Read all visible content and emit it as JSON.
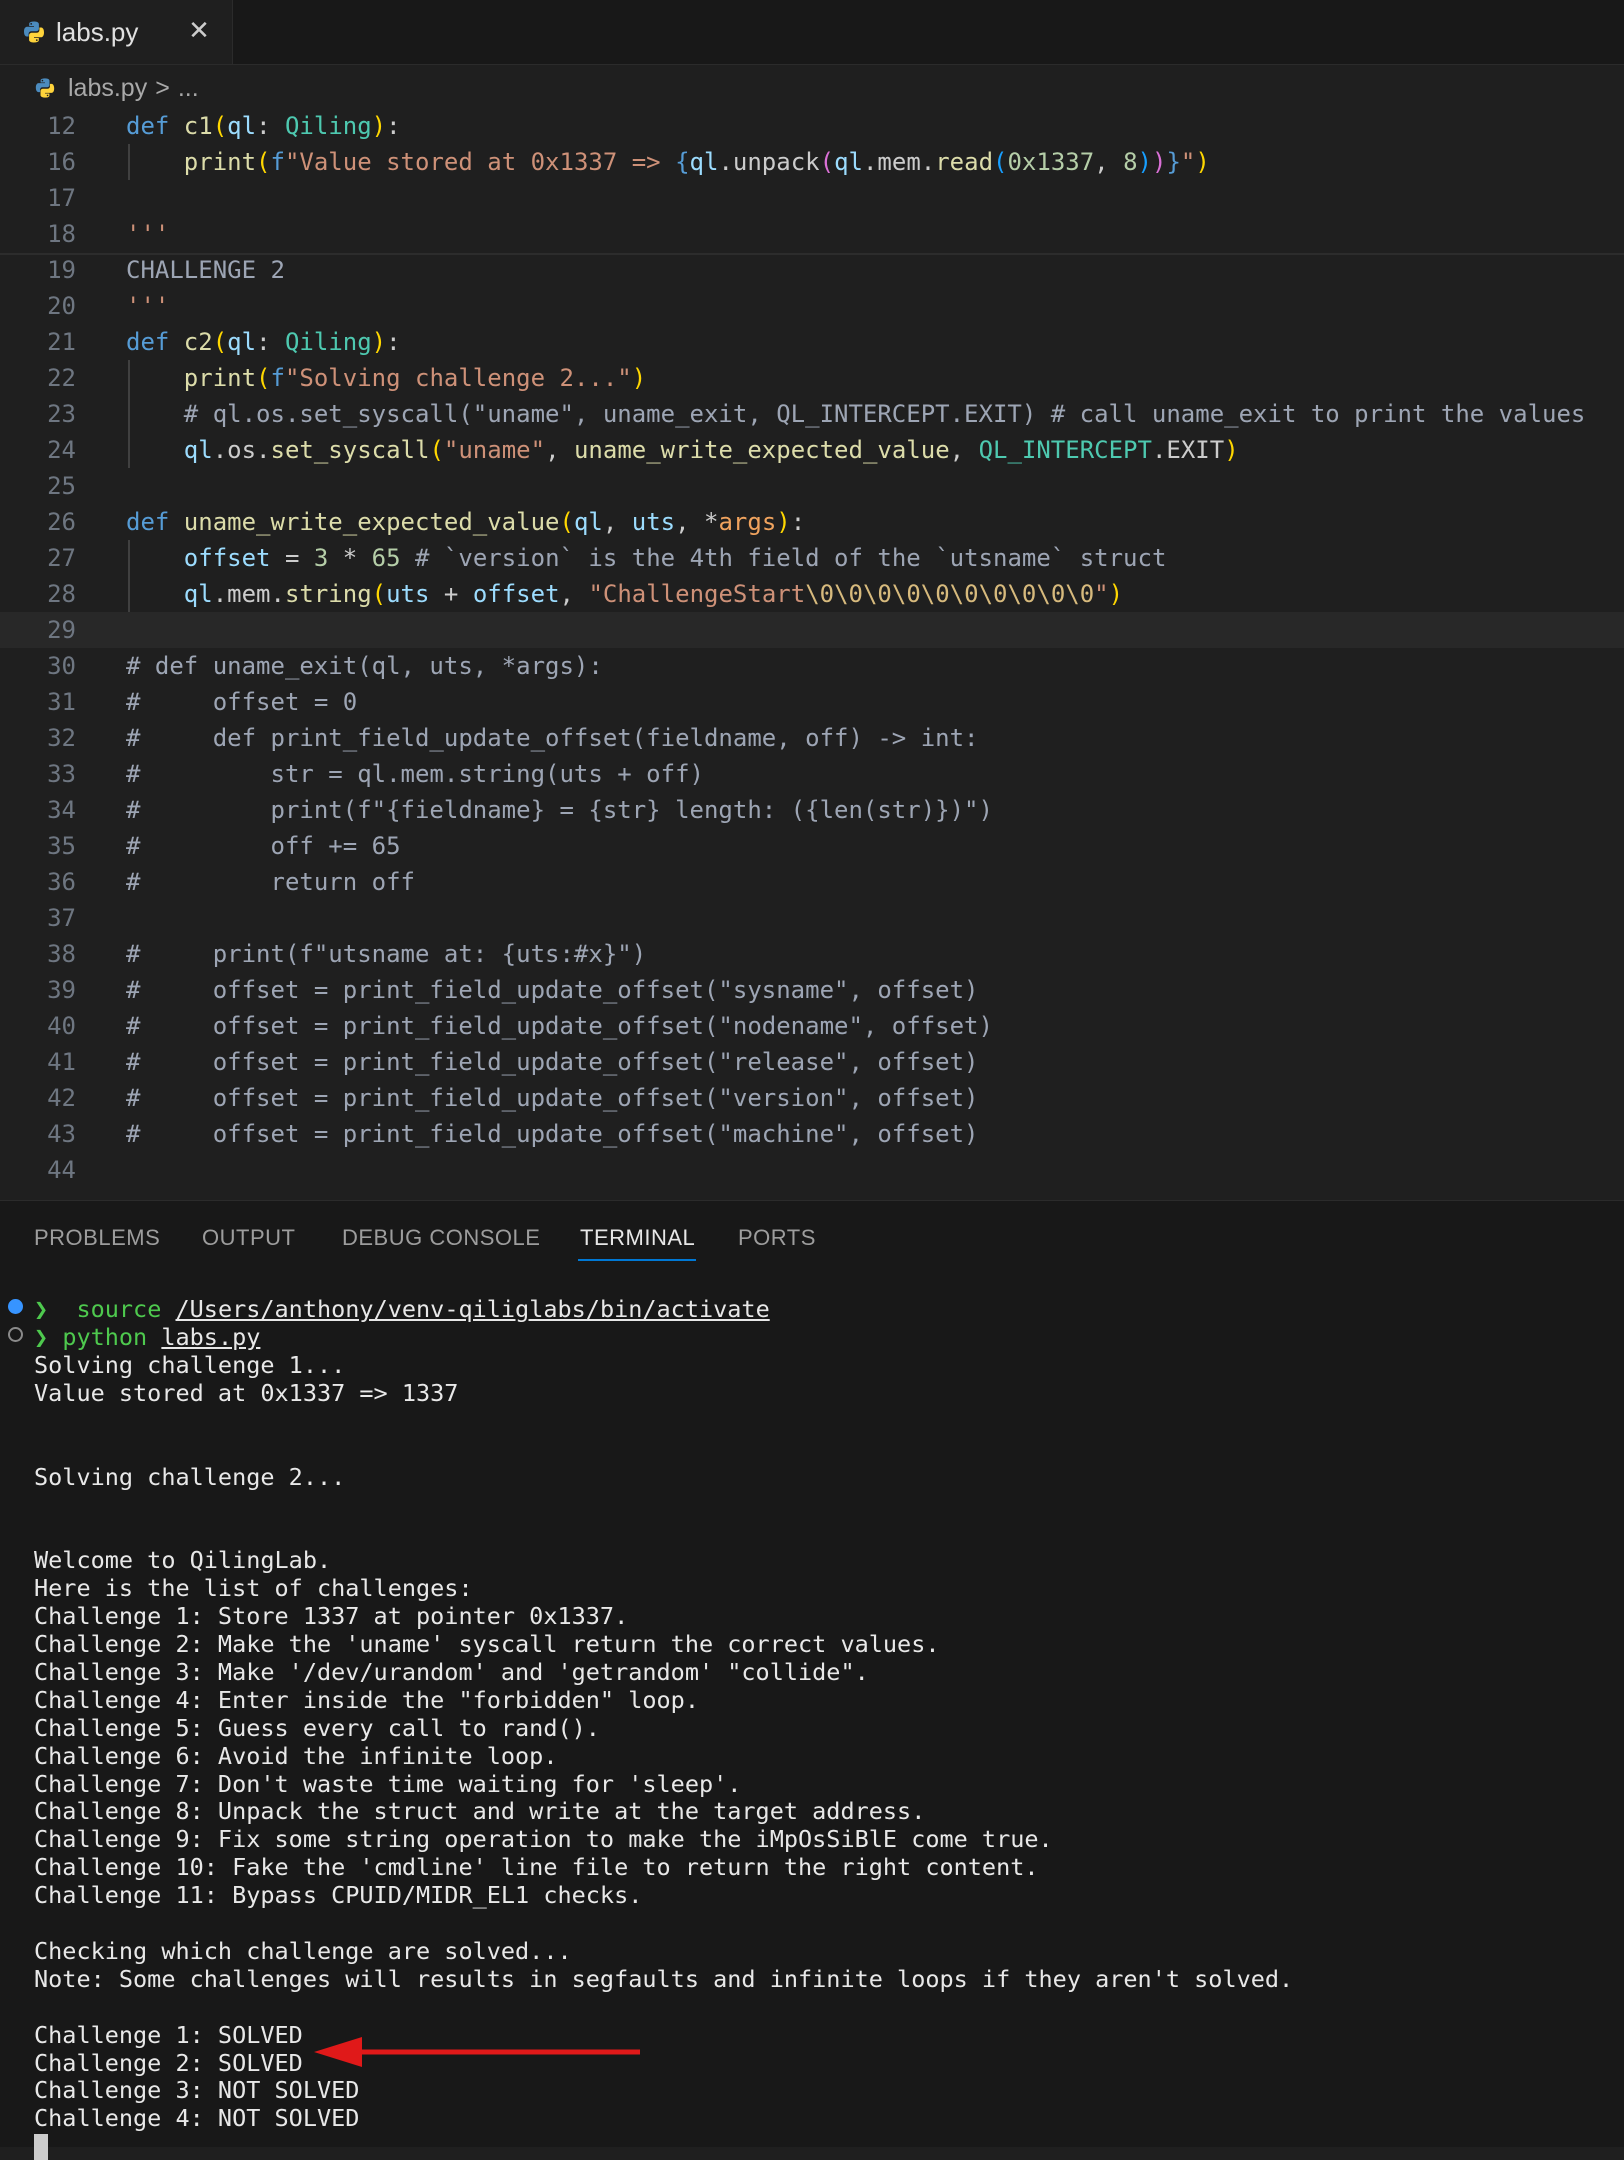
{
  "tab": {
    "title": "labs.py",
    "icon": "python-icon"
  },
  "breadcrumb": {
    "file": "labs.py",
    "separator": ">",
    "more": "..."
  },
  "editor": {
    "lines": [
      {
        "n": "12",
        "tokens": [
          [
            "kw",
            "def "
          ],
          [
            "fn",
            "c1"
          ],
          [
            "b1",
            "("
          ],
          [
            "pm",
            "ql"
          ],
          [
            "",
            ""
          ],
          [
            "",
            ": "
          ],
          [
            "ty",
            "Qiling"
          ],
          [
            "b1",
            ")"
          ],
          [
            "",
            ":"
          ]
        ]
      },
      {
        "n": "16",
        "guide": true,
        "tokens": [
          [
            "",
            "    "
          ],
          [
            "fn",
            "print"
          ],
          [
            "b1",
            "("
          ],
          [
            "kw",
            "f"
          ],
          [
            "st",
            "\"Value stored at 0x1337 => "
          ],
          [
            "kw",
            "{"
          ],
          [
            "pm",
            "ql"
          ],
          [
            "",
            ".unpack"
          ],
          [
            "b2",
            "("
          ],
          [
            "pm",
            "ql"
          ],
          [
            "",
            ".mem."
          ],
          [
            "fn",
            "read"
          ],
          [
            "b3",
            "("
          ],
          [
            "nm",
            "0x1337"
          ],
          [
            "",
            ", "
          ],
          [
            "nm",
            "8"
          ],
          [
            "b3",
            ")"
          ],
          [
            "b2",
            ")"
          ],
          [
            "kw",
            "}"
          ],
          [
            "st",
            "\""
          ],
          [
            "b1",
            ")"
          ]
        ]
      },
      {
        "n": "17",
        "tokens": []
      },
      {
        "n": "18",
        "tokens": [
          [
            "st",
            "'''"
          ]
        ]
      },
      {
        "n": "19",
        "tokens": [
          [
            "cm2",
            "CHALLENGE 2"
          ]
        ]
      },
      {
        "n": "20",
        "tokens": [
          [
            "st",
            "'''"
          ]
        ]
      },
      {
        "n": "21",
        "tokens": [
          [
            "kw",
            "def "
          ],
          [
            "fn",
            "c2"
          ],
          [
            "b1",
            "("
          ],
          [
            "pm",
            "ql"
          ],
          [
            "",
            ": "
          ],
          [
            "ty",
            "Qiling"
          ],
          [
            "b1",
            ")"
          ],
          [
            "",
            ":"
          ]
        ]
      },
      {
        "n": "22",
        "guide": true,
        "tokens": [
          [
            "",
            "    "
          ],
          [
            "fn",
            "print"
          ],
          [
            "b1",
            "("
          ],
          [
            "kw",
            "f"
          ],
          [
            "st",
            "\"Solving challenge 2...\""
          ],
          [
            "b1",
            ")"
          ]
        ]
      },
      {
        "n": "23",
        "guide": true,
        "tokens": [
          [
            "",
            "    "
          ],
          [
            "cm2",
            "# ql.os.set_syscall(\"uname\", uname_exit, QL_INTERCEPT.EXIT) # call uname_exit to print the values"
          ]
        ]
      },
      {
        "n": "24",
        "guide": true,
        "tokens": [
          [
            "",
            "    "
          ],
          [
            "pm",
            "ql"
          ],
          [
            "",
            ".os."
          ],
          [
            "fn",
            "set_syscall"
          ],
          [
            "b1",
            "("
          ],
          [
            "st",
            "\"uname\""
          ],
          [
            "",
            ", "
          ],
          [
            "fn",
            "uname_write_expected_value"
          ],
          [
            "",
            ", "
          ],
          [
            "ty",
            "QL_INTERCEPT"
          ],
          [
            "",
            ".EXIT"
          ],
          [
            "b1",
            ")"
          ]
        ]
      },
      {
        "n": "25",
        "tokens": []
      },
      {
        "n": "26",
        "tokens": [
          [
            "kw",
            "def "
          ],
          [
            "fn",
            "uname_write_expected_value"
          ],
          [
            "b1",
            "("
          ],
          [
            "pm",
            "ql"
          ],
          [
            "",
            ", "
          ],
          [
            "pm",
            "uts"
          ],
          [
            "",
            ", *"
          ],
          [
            "arg",
            "args"
          ],
          [
            "b1",
            ")"
          ],
          [
            "",
            ":"
          ]
        ]
      },
      {
        "n": "27",
        "guide": true,
        "tokens": [
          [
            "",
            "    "
          ],
          [
            "pm",
            "offset"
          ],
          [
            "",
            " = "
          ],
          [
            "nm",
            "3"
          ],
          [
            "",
            " * "
          ],
          [
            "nm",
            "65"
          ],
          [
            "cm2",
            " # `version` is the 4th field of the `utsname` struct"
          ]
        ]
      },
      {
        "n": "28",
        "guide": true,
        "tokens": [
          [
            "",
            "    "
          ],
          [
            "pm",
            "ql"
          ],
          [
            "",
            ".mem."
          ],
          [
            "fn",
            "string"
          ],
          [
            "b1",
            "("
          ],
          [
            "pm",
            "uts"
          ],
          [
            "",
            " + "
          ],
          [
            "pm",
            "offset"
          ],
          [
            "",
            ", "
          ],
          [
            "st",
            "\"ChallengeStart"
          ],
          [
            "dq",
            "\\0\\0\\0\\0\\0\\0\\0\\0\\0\\0"
          ],
          [
            "st",
            "\""
          ],
          [
            "b1",
            ")"
          ]
        ]
      },
      {
        "n": "29",
        "current": true,
        "tokens": []
      },
      {
        "n": "30",
        "tokens": [
          [
            "cm2",
            "# def uname_exit(ql, uts, *args):"
          ]
        ]
      },
      {
        "n": "31",
        "tokens": [
          [
            "cm2",
            "#     offset = 0"
          ]
        ]
      },
      {
        "n": "32",
        "tokens": [
          [
            "cm2",
            "#     def print_field_update_offset(fieldname, off) -> int:"
          ]
        ]
      },
      {
        "n": "33",
        "tokens": [
          [
            "cm2",
            "#         str = ql.mem.string(uts + off)"
          ]
        ]
      },
      {
        "n": "34",
        "tokens": [
          [
            "cm2",
            "#         print(f\"{fieldname} = {str} length: ({len(str)})\")"
          ]
        ]
      },
      {
        "n": "35",
        "tokens": [
          [
            "cm2",
            "#         off += 65"
          ]
        ]
      },
      {
        "n": "36",
        "tokens": [
          [
            "cm2",
            "#         return off"
          ]
        ]
      },
      {
        "n": "37",
        "tokens": []
      },
      {
        "n": "38",
        "tokens": [
          [
            "cm2",
            "#     print(f\"utsname at: {uts:#x}\")"
          ]
        ]
      },
      {
        "n": "39",
        "tokens": [
          [
            "cm2",
            "#     offset = print_field_update_offset(\"sysname\", offset)"
          ]
        ]
      },
      {
        "n": "40",
        "tokens": [
          [
            "cm2",
            "#     offset = print_field_update_offset(\"nodename\", offset)"
          ]
        ]
      },
      {
        "n": "41",
        "tokens": [
          [
            "cm2",
            "#     offset = print_field_update_offset(\"release\", offset)"
          ]
        ]
      },
      {
        "n": "42",
        "tokens": [
          [
            "cm2",
            "#     offset = print_field_update_offset(\"version\", offset)"
          ]
        ]
      },
      {
        "n": "43",
        "tokens": [
          [
            "cm2",
            "#     offset = print_field_update_offset(\"machine\", offset)"
          ]
        ]
      },
      {
        "n": "44",
        "tokens": []
      }
    ]
  },
  "panel": {
    "tabs": [
      {
        "label": "PROBLEMS",
        "active": false
      },
      {
        "label": "OUTPUT",
        "active": false
      },
      {
        "label": "DEBUG CONSOLE",
        "active": false
      },
      {
        "label": "TERMINAL",
        "active": true
      },
      {
        "label": "PORTS",
        "active": false
      }
    ]
  },
  "terminal": {
    "cmd1": {
      "prompt": "❯",
      "command": "source",
      "arg": "/Users/anthony/venv-qiliglabs/bin/activate"
    },
    "cmd2": {
      "prompt": "❯",
      "command": "python",
      "arg": "labs.py"
    },
    "output": [
      "Solving challenge 1...",
      "Value stored at 0x1337 => 1337",
      "",
      "",
      "Solving challenge 2...",
      "",
      "",
      "Welcome to QilingLab.",
      "Here is the list of challenges:",
      "Challenge 1: Store 1337 at pointer 0x1337.",
      "Challenge 2: Make the 'uname' syscall return the correct values.",
      "Challenge 3: Make '/dev/urandom' and 'getrandom' \"collide\".",
      "Challenge 4: Enter inside the \"forbidden\" loop.",
      "Challenge 5: Guess every call to rand().",
      "Challenge 6: Avoid the infinite loop.",
      "Challenge 7: Don't waste time waiting for 'sleep'.",
      "Challenge 8: Unpack the struct and write at the target address.",
      "Challenge 9: Fix some string operation to make the iMpOsSiBlE come true.",
      "Challenge 10: Fake the 'cmdline' line file to return the right content.",
      "Challenge 11: Bypass CPUID/MIDR_EL1 checks.",
      "",
      "Checking which challenge are solved...",
      "Note: Some challenges will results in segfaults and infinite loops if they aren't solved.",
      "",
      "Challenge 1: SOLVED",
      "Challenge 2: SOLVED",
      "Challenge 3: NOT SOLVED",
      "Challenge 4: NOT SOLVED"
    ]
  },
  "colors": {
    "accent": "#0078d4",
    "annotation_arrow": "#e01919",
    "background": "#1f1f1f"
  }
}
